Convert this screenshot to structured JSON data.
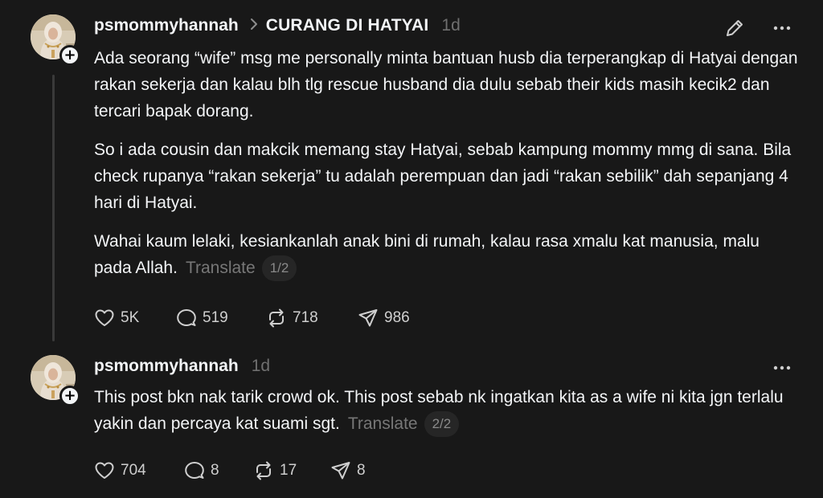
{
  "posts": [
    {
      "username": "psmommyhannah",
      "community": "CURANG DI HATYAI",
      "time": "1d",
      "paragraphs": [
        "Ada seorang “wife” msg me personally minta bantuan husb dia terperangkap di Hatyai dengan rakan sekerja dan kalau blh tlg rescue husband dia dulu sebab their kids masih kecik2 dan tercari bapak dorang.",
        "So i ada cousin dan makcik memang stay Hatyai, sebab kampung mommy mmg di sana. Bila check rupanya “rakan sekerja” tu adalah perempuan dan jadi “rakan sebilik” dah sepanjang 4 hari di Hatyai.",
        "Wahai kaum lelaki, kesiankanlah anak bini di rumah, kalau rasa xmalu kat manusia, malu pada Allah."
      ],
      "translate": "Translate",
      "page": "1/2",
      "likes": "5K",
      "replies": "519",
      "reposts": "718",
      "shares": "986",
      "icons": [
        "heart-icon",
        "comment-icon",
        "repost-icon",
        "share-icon",
        "edit-icon",
        "more-icon",
        "plus-icon"
      ]
    },
    {
      "username": "psmommyhannah",
      "time": "1d",
      "paragraphs": [
        "This post bkn nak tarik crowd ok. This post sebab nk ingatkan kita as a wife ni kita jgn terlalu yakin dan percaya kat suami sgt."
      ],
      "translate": "Translate",
      "page": "2/2",
      "likes": "704",
      "replies": "8",
      "reposts": "17",
      "shares": "8"
    }
  ],
  "colors": {
    "background": "#181818",
    "text": "#f3f5f7",
    "muted": "#777777",
    "thread_line": "#3a3a3a"
  }
}
